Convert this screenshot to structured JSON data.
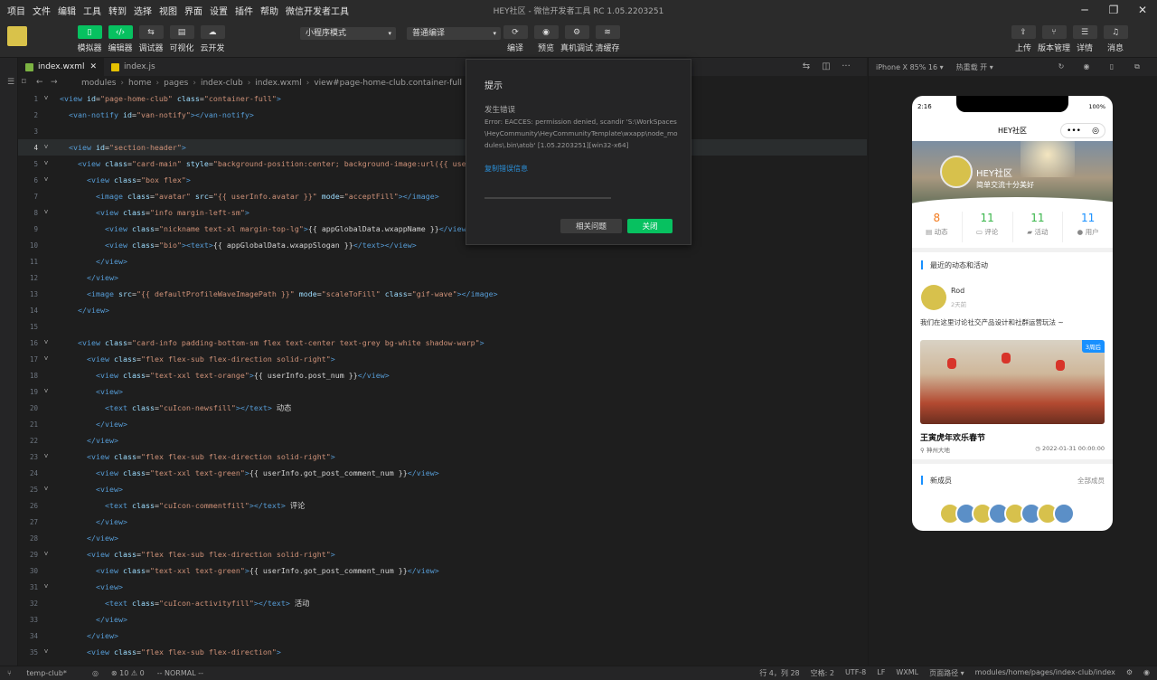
{
  "menubar": {
    "items": [
      "项目",
      "文件",
      "编辑",
      "工具",
      "转到",
      "选择",
      "视图",
      "界面",
      "设置",
      "插件",
      "帮助",
      "微信开发者工具"
    ],
    "title": "HEY社区 - 微信开发者工具 RC 1.05.2203251"
  },
  "toolbar": {
    "left_buttons": [
      {
        "icon": "mobile-icon",
        "label": "模拟器",
        "active": true
      },
      {
        "icon": "code-icon",
        "label": "编辑器",
        "active": true
      },
      {
        "icon": "debug-icon",
        "label": "调试器",
        "active": false
      },
      {
        "icon": "visual-icon",
        "label": "可视化",
        "active": false
      },
      {
        "icon": "cloud-icon",
        "label": "云开发",
        "active": false
      }
    ],
    "mode_select": "小程序模式",
    "compile_select": "普通编译",
    "mid_buttons": [
      {
        "icon": "compile-icon",
        "label": "编译"
      },
      {
        "icon": "preview-icon",
        "label": "预览"
      },
      {
        "icon": "device-debug-icon",
        "label": "真机调试"
      },
      {
        "icon": "clear-cache-icon",
        "label": "清缓存"
      }
    ],
    "right_buttons": [
      {
        "icon": "upload-icon",
        "label": "上传"
      },
      {
        "icon": "version-icon",
        "label": "版本管理"
      },
      {
        "icon": "details-icon",
        "label": "详情"
      },
      {
        "icon": "bell-icon",
        "label": "消息"
      }
    ]
  },
  "tabs": [
    {
      "name": "index.wxml",
      "active": true,
      "color": "#7cb342"
    },
    {
      "name": "index.js",
      "active": false,
      "color": "#e5c100"
    }
  ],
  "breadcrumb": [
    "modules",
    "home",
    "pages",
    "index-club",
    "index.wxml",
    "view#page-home-club.container-full"
  ],
  "editor": {
    "lines": [
      {
        "n": "1",
        "fold": "˅",
        "indent": 0,
        "parts": [
          [
            "tag",
            "<view "
          ],
          [
            "attr",
            "id"
          ],
          [
            "txt",
            "="
          ],
          [
            "str",
            "\"page-home-club\""
          ],
          [
            "attr",
            " class"
          ],
          [
            "txt",
            "="
          ],
          [
            "str",
            "\"container-full\""
          ],
          [
            "tag",
            ">"
          ]
        ]
      },
      {
        "n": "2",
        "fold": "",
        "indent": 1,
        "parts": [
          [
            "tag",
            "<van-notify "
          ],
          [
            "attr",
            "id"
          ],
          [
            "txt",
            "="
          ],
          [
            "str",
            "\"van-notify\""
          ],
          [
            "tag",
            "></van-notify>"
          ]
        ]
      },
      {
        "n": "3",
        "fold": "",
        "indent": 0,
        "parts": []
      },
      {
        "n": "4",
        "fold": "˅",
        "indent": 1,
        "hl": true,
        "parts": [
          [
            "tag",
            "<view "
          ],
          [
            "attr",
            "id"
          ],
          [
            "txt",
            "="
          ],
          [
            "str",
            "\"section-header\""
          ],
          [
            "tag",
            ">"
          ]
        ]
      },
      {
        "n": "5",
        "fold": "˅",
        "indent": 2,
        "parts": [
          [
            "tag",
            "<view "
          ],
          [
            "attr",
            "class"
          ],
          [
            "txt",
            "="
          ],
          [
            "str",
            "\"card-main\""
          ],
          [
            "attr",
            " style"
          ],
          [
            "txt",
            "="
          ],
          [
            "str",
            "\"background-position:center; background-image:url({{ userInfo"
          ]
        ]
      },
      {
        "n": "6",
        "fold": "˅",
        "indent": 3,
        "parts": [
          [
            "tag",
            "<view "
          ],
          [
            "attr",
            "class"
          ],
          [
            "txt",
            "="
          ],
          [
            "str",
            "\"box flex\""
          ],
          [
            "tag",
            ">"
          ]
        ]
      },
      {
        "n": "7",
        "fold": "",
        "indent": 4,
        "parts": [
          [
            "tag",
            "<image "
          ],
          [
            "attr",
            "class"
          ],
          [
            "txt",
            "="
          ],
          [
            "str",
            "\"avatar\""
          ],
          [
            "attr",
            " src"
          ],
          [
            "txt",
            "="
          ],
          [
            "str",
            "\"{{ userInfo.avatar }}\""
          ],
          [
            "attr",
            " mode"
          ],
          [
            "txt",
            "="
          ],
          [
            "str",
            "\"acceptFill\""
          ],
          [
            "tag",
            "></image>"
          ]
        ]
      },
      {
        "n": "8",
        "fold": "˅",
        "indent": 4,
        "parts": [
          [
            "tag",
            "<view "
          ],
          [
            "attr",
            "class"
          ],
          [
            "txt",
            "="
          ],
          [
            "str",
            "\"info margin-left-sm\""
          ],
          [
            "tag",
            ">"
          ]
        ]
      },
      {
        "n": "9",
        "fold": "",
        "indent": 5,
        "parts": [
          [
            "tag",
            "<view "
          ],
          [
            "attr",
            "class"
          ],
          [
            "txt",
            "="
          ],
          [
            "str",
            "\"nickname text-xl margin-top-lg\""
          ],
          [
            "tag",
            ">"
          ],
          [
            "txt",
            "{{ appGlobalData.wxappName }}"
          ],
          [
            "tag",
            "</view>"
          ]
        ]
      },
      {
        "n": "10",
        "fold": "",
        "indent": 5,
        "parts": [
          [
            "tag",
            "<view "
          ],
          [
            "attr",
            "class"
          ],
          [
            "txt",
            "="
          ],
          [
            "str",
            "\"bio\""
          ],
          [
            "tag",
            "><text>"
          ],
          [
            "txt",
            "{{ appGlobalData.wxappSlogan }}"
          ],
          [
            "tag",
            "</text></view>"
          ]
        ]
      },
      {
        "n": "11",
        "fold": "",
        "indent": 4,
        "parts": [
          [
            "tag",
            "</view>"
          ]
        ]
      },
      {
        "n": "12",
        "fold": "",
        "indent": 3,
        "parts": [
          [
            "tag",
            "</view>"
          ]
        ]
      },
      {
        "n": "13",
        "fold": "",
        "indent": 3,
        "parts": [
          [
            "tag",
            "<image "
          ],
          [
            "attr",
            "src"
          ],
          [
            "txt",
            "="
          ],
          [
            "str",
            "\"{{ defaultProfileWaveImagePath }}\""
          ],
          [
            "attr",
            " mode"
          ],
          [
            "txt",
            "="
          ],
          [
            "str",
            "\"scaleToFill\""
          ],
          [
            "attr",
            " class"
          ],
          [
            "txt",
            "="
          ],
          [
            "str",
            "\"gif-wave\""
          ],
          [
            "tag",
            "></image>"
          ]
        ]
      },
      {
        "n": "14",
        "fold": "",
        "indent": 2,
        "parts": [
          [
            "tag",
            "</view>"
          ]
        ]
      },
      {
        "n": "15",
        "fold": "",
        "indent": 0,
        "parts": []
      },
      {
        "n": "16",
        "fold": "˅",
        "indent": 2,
        "parts": [
          [
            "tag",
            "<view "
          ],
          [
            "attr",
            "class"
          ],
          [
            "txt",
            "="
          ],
          [
            "str",
            "\"card-info padding-bottom-sm flex text-center text-grey bg-white shadow-warp\""
          ],
          [
            "tag",
            ">"
          ]
        ]
      },
      {
        "n": "17",
        "fold": "˅",
        "indent": 3,
        "parts": [
          [
            "tag",
            "<view "
          ],
          [
            "attr",
            "class"
          ],
          [
            "txt",
            "="
          ],
          [
            "str",
            "\"flex flex-sub flex-direction solid-right\""
          ],
          [
            "tag",
            ">"
          ]
        ]
      },
      {
        "n": "18",
        "fold": "",
        "indent": 4,
        "parts": [
          [
            "tag",
            "<view "
          ],
          [
            "attr",
            "class"
          ],
          [
            "txt",
            "="
          ],
          [
            "str",
            "\"text-xxl text-orange\""
          ],
          [
            "tag",
            ">"
          ],
          [
            "txt",
            "{{ userInfo.post_num }}"
          ],
          [
            "tag",
            "</view>"
          ]
        ]
      },
      {
        "n": "19",
        "fold": "˅",
        "indent": 4,
        "parts": [
          [
            "tag",
            "<view>"
          ]
        ]
      },
      {
        "n": "20",
        "fold": "",
        "indent": 5,
        "parts": [
          [
            "tag",
            "<text "
          ],
          [
            "attr",
            "class"
          ],
          [
            "txt",
            "="
          ],
          [
            "str",
            "\"cuIcon-newsfill\""
          ],
          [
            "tag",
            "></text>"
          ],
          [
            "txt",
            " 动态"
          ]
        ]
      },
      {
        "n": "21",
        "fold": "",
        "indent": 4,
        "parts": [
          [
            "tag",
            "</view>"
          ]
        ]
      },
      {
        "n": "22",
        "fold": "",
        "indent": 3,
        "parts": [
          [
            "tag",
            "</view>"
          ]
        ]
      },
      {
        "n": "23",
        "fold": "˅",
        "indent": 3,
        "parts": [
          [
            "tag",
            "<view "
          ],
          [
            "attr",
            "class"
          ],
          [
            "txt",
            "="
          ],
          [
            "str",
            "\"flex flex-sub flex-direction solid-right\""
          ],
          [
            "tag",
            ">"
          ]
        ]
      },
      {
        "n": "24",
        "fold": "",
        "indent": 4,
        "parts": [
          [
            "tag",
            "<view "
          ],
          [
            "attr",
            "class"
          ],
          [
            "txt",
            "="
          ],
          [
            "str",
            "\"text-xxl text-green\""
          ],
          [
            "tag",
            ">"
          ],
          [
            "txt",
            "{{ userInfo.got_post_comment_num }}"
          ],
          [
            "tag",
            "</view>"
          ]
        ]
      },
      {
        "n": "25",
        "fold": "˅",
        "indent": 4,
        "parts": [
          [
            "tag",
            "<view>"
          ]
        ]
      },
      {
        "n": "26",
        "fold": "",
        "indent": 5,
        "parts": [
          [
            "tag",
            "<text "
          ],
          [
            "attr",
            "class"
          ],
          [
            "txt",
            "="
          ],
          [
            "str",
            "\"cuIcon-commentfill\""
          ],
          [
            "tag",
            "></text>"
          ],
          [
            "txt",
            " 评论"
          ]
        ]
      },
      {
        "n": "27",
        "fold": "",
        "indent": 4,
        "parts": [
          [
            "tag",
            "</view>"
          ]
        ]
      },
      {
        "n": "28",
        "fold": "",
        "indent": 3,
        "parts": [
          [
            "tag",
            "</view>"
          ]
        ]
      },
      {
        "n": "29",
        "fold": "˅",
        "indent": 3,
        "parts": [
          [
            "tag",
            "<view "
          ],
          [
            "attr",
            "class"
          ],
          [
            "txt",
            "="
          ],
          [
            "str",
            "\"flex flex-sub flex-direction solid-right\""
          ],
          [
            "tag",
            ">"
          ]
        ]
      },
      {
        "n": "30",
        "fold": "",
        "indent": 4,
        "parts": [
          [
            "tag",
            "<view "
          ],
          [
            "attr",
            "class"
          ],
          [
            "txt",
            "="
          ],
          [
            "str",
            "\"text-xxl text-green\""
          ],
          [
            "tag",
            ">"
          ],
          [
            "txt",
            "{{ userInfo.got_post_comment_num }}"
          ],
          [
            "tag",
            "</view>"
          ]
        ]
      },
      {
        "n": "31",
        "fold": "˅",
        "indent": 4,
        "parts": [
          [
            "tag",
            "<view>"
          ]
        ]
      },
      {
        "n": "32",
        "fold": "",
        "indent": 5,
        "parts": [
          [
            "tag",
            "<text "
          ],
          [
            "attr",
            "class"
          ],
          [
            "txt",
            "="
          ],
          [
            "str",
            "\"cuIcon-activityfill\""
          ],
          [
            "tag",
            "></text>"
          ],
          [
            "txt",
            " 活动"
          ]
        ]
      },
      {
        "n": "33",
        "fold": "",
        "indent": 4,
        "parts": [
          [
            "tag",
            "</view>"
          ]
        ]
      },
      {
        "n": "34",
        "fold": "",
        "indent": 3,
        "parts": [
          [
            "tag",
            "</view>"
          ]
        ]
      },
      {
        "n": "35",
        "fold": "˅",
        "indent": 3,
        "parts": [
          [
            "tag",
            "<view "
          ],
          [
            "attr",
            "class"
          ],
          [
            "txt",
            "="
          ],
          [
            "str",
            "\"flex flex-sub flex-direction\""
          ],
          [
            "tag",
            ">"
          ]
        ]
      }
    ]
  },
  "dialog": {
    "title": "提示",
    "heading": "发生错误",
    "message": "Error: EACCES: permission denied, scandir 'S:\\WorkSpaces\\HeyCommunity\\HeyCommunityTemplate\\wxapp\\node_modules\\.bin\\atob' [1.05.2203251][win32-x64]",
    "copy_link": "复制错误信息",
    "btn_related": "相关问题",
    "btn_close": "关闭"
  },
  "simulator": {
    "device": "iPhone X 85% 16 ▾",
    "hot_reload": "热重载 开 ▾",
    "phone": {
      "time": "2:16",
      "battery": "100%",
      "nav_title": "HEY社区",
      "hero_name": "HEY社区",
      "hero_bio": "简单交流十分美好",
      "stats": [
        {
          "value": "8",
          "label": "动态",
          "icon": "news-icon",
          "color": "#f37b1d"
        },
        {
          "value": "11",
          "label": "评论",
          "icon": "comment-icon",
          "color": "#39b54a"
        },
        {
          "value": "11",
          "label": "活动",
          "icon": "activity-icon",
          "color": "#39b54a"
        },
        {
          "value": "11",
          "label": "用户",
          "icon": "user-icon",
          "color": "#1890ff"
        }
      ],
      "recent_title": "最近的动态和活动",
      "post_user": "Rod",
      "post_time": "2天前",
      "post_text": "我们在这里讨论社交产品设计和社群运营玩法 ~",
      "post_badge": "3周后",
      "activity_title": "王寅虎年欢乐春节",
      "activity_location": "神州大地",
      "activity_date": "2022-01-31 00:00:00",
      "members_title": "新成员",
      "members_more": "全部成员"
    }
  },
  "statusbar": {
    "branch": "temp-club*",
    "problems": "⊗ 10 ⚠ 0",
    "mode": "-- NORMAL --",
    "position": "行 4，列 28",
    "spaces": "空格: 2",
    "encoding": "UTF-8",
    "eol": "LF",
    "lang": "WXML",
    "page_path_label": "页面路径 ▾",
    "page_path": "modules/home/pages/index-club/index"
  }
}
